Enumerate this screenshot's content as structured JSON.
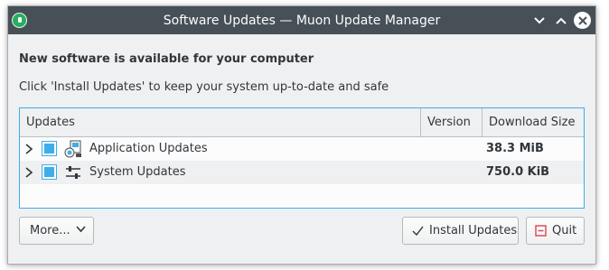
{
  "window": {
    "title": "Software Updates — Muon Update Manager"
  },
  "message": {
    "heading": "New software is available for your computer",
    "subheading": "Click 'Install Updates' to keep your system up-to-date and safe"
  },
  "table": {
    "columns": [
      "Updates",
      "Version",
      "Download Size"
    ],
    "rows": [
      {
        "label": "Application Updates",
        "version": "",
        "size": "38.3 MiB",
        "icon": "application-updates-icon",
        "checked": true,
        "expanded": false
      },
      {
        "label": "System Updates",
        "version": "",
        "size": "750.0 KiB",
        "icon": "system-updates-icon",
        "checked": true,
        "expanded": false
      }
    ]
  },
  "buttons": {
    "more": "More...",
    "install": "Install Updates",
    "quit": "Quit"
  },
  "colors": {
    "titlebar": "#475057",
    "accent": "#3daee9",
    "quit_icon": "#da4453"
  }
}
